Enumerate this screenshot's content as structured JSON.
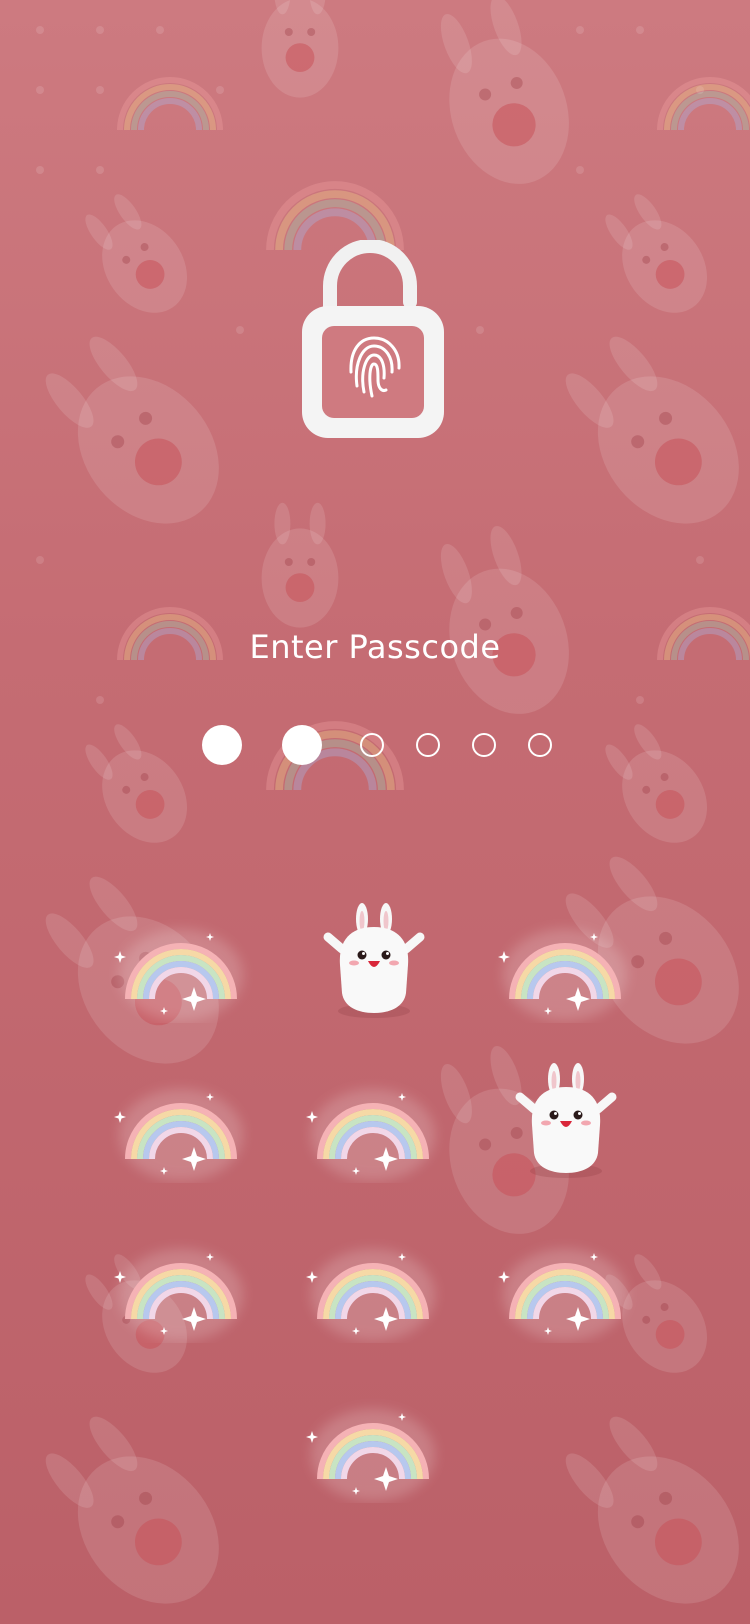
{
  "screen": {
    "title": "Enter Passcode",
    "colors": {
      "background_top": "#cd7a80",
      "background_bottom": "#bb6068",
      "foreground": "#ffffff"
    },
    "lock_icon": "padlock-open-fingerprint-icon"
  },
  "passcode": {
    "length": 6,
    "entered": 2
  },
  "keypad": {
    "rows": [
      [
        {
          "name": "key-1",
          "icon": "rainbow-icon"
        },
        {
          "name": "key-2",
          "icon": "bunny-icon"
        },
        {
          "name": "key-3",
          "icon": "rainbow-icon"
        }
      ],
      [
        {
          "name": "key-4",
          "icon": "rainbow-icon"
        },
        {
          "name": "key-5",
          "icon": "rainbow-icon"
        },
        {
          "name": "key-6",
          "icon": "bunny-icon"
        }
      ],
      [
        {
          "name": "key-7",
          "icon": "rainbow-icon"
        },
        {
          "name": "key-8",
          "icon": "rainbow-icon"
        },
        {
          "name": "key-9",
          "icon": "rainbow-icon"
        }
      ],
      [
        {
          "name": "key-0",
          "icon": "rainbow-icon"
        }
      ]
    ]
  }
}
